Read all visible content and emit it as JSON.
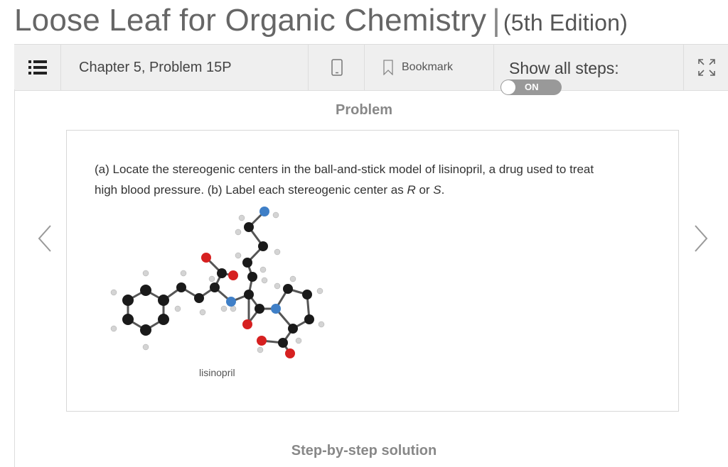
{
  "book": {
    "title": "Loose Leaf for Organic Chemistry",
    "separator": "|",
    "edition": "(5th Edition)"
  },
  "toolbar": {
    "toc_icon": "list-icon",
    "chapter_label": "Chapter 5, Problem 15P",
    "mobile_icon": "mobile-phone-icon",
    "bookmark_icon": "bookmark-icon",
    "bookmark_label": "Bookmark",
    "steps_label": "Show all steps:",
    "toggle_label": "ON",
    "expand_icon": "expand-icon"
  },
  "problem": {
    "heading": "Problem",
    "line1": "(a) Locate the stereogenic centers in the ball-and-stick model of lisinopril, a drug used to treat",
    "line2_a": "high blood pressure. (b) Label each stereogenic center as ",
    "line2_r": "R",
    "line2_or": " or ",
    "line2_s": "S",
    "line2_end": ".",
    "molecule_label": "lisinopril"
  },
  "solution": {
    "heading": "Step-by-step solution"
  },
  "nav": {
    "prev_icon": "chevron-left-icon",
    "next_icon": "chevron-right-icon"
  },
  "colors": {
    "carbon": "#1a1a1a",
    "hydrogen": "#d4d4d4",
    "oxygen": "#d62020",
    "nitrogen": "#3f7fc7",
    "toggle": "#999999"
  }
}
